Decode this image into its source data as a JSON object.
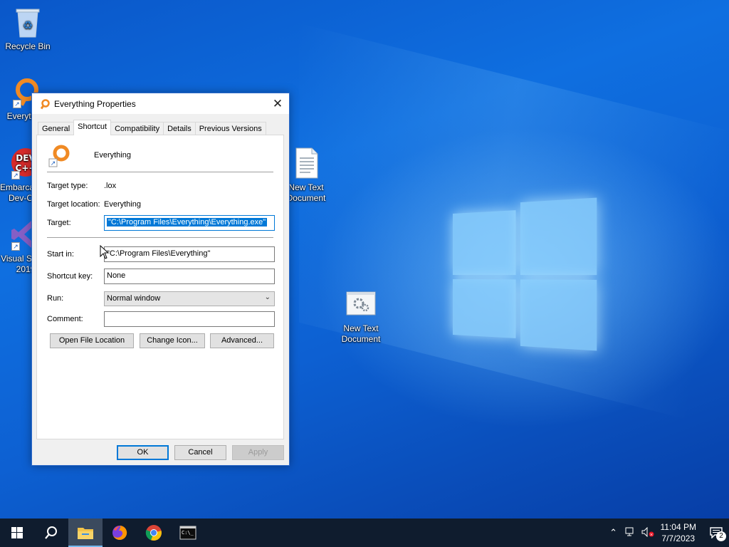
{
  "desktop": {
    "icons": [
      {
        "label": "Recycle Bin"
      },
      {
        "label": "Everything"
      },
      {
        "label": "Embarcadero Dev-C++"
      },
      {
        "label": "Visual Studio 2019"
      },
      {
        "label": "New Text Document"
      },
      {
        "label": "New Text Document"
      }
    ]
  },
  "dialog": {
    "title": "Everything Properties",
    "tabs": [
      "General",
      "Shortcut",
      "Compatibility",
      "Details",
      "Previous Versions"
    ],
    "active_tab": "Shortcut",
    "shortcut_name": "Everything",
    "target_type_label": "Target type:",
    "target_type_value": ".lox",
    "target_location_label": "Target location:",
    "target_location_value": "Everything",
    "target_label": "Target:",
    "target_value": "\"C:\\Program Files\\Everything\\Everything.exe\"",
    "start_in_label": "Start in:",
    "start_in_value": "\"C:\\Program Files\\Everything\"",
    "shortcut_key_label": "Shortcut key:",
    "shortcut_key_value": "None",
    "run_label": "Run:",
    "run_value": "Normal window",
    "comment_label": "Comment:",
    "comment_value": "",
    "open_file_location": "Open File Location",
    "change_icon": "Change Icon...",
    "advanced": "Advanced...",
    "ok": "OK",
    "cancel": "Cancel",
    "apply": "Apply"
  },
  "taskbar": {
    "time": "11:04 PM",
    "date": "7/7/2023",
    "notification_count": "2",
    "pinned": [
      "start-icon",
      "search-icon",
      "file-explorer-icon",
      "firefox-icon",
      "chrome-icon",
      "terminal-icon"
    ]
  },
  "colors": {
    "accent": "#0078d7",
    "taskbar": "#0f1c2e",
    "wallpaper": "#0f6fe0"
  }
}
